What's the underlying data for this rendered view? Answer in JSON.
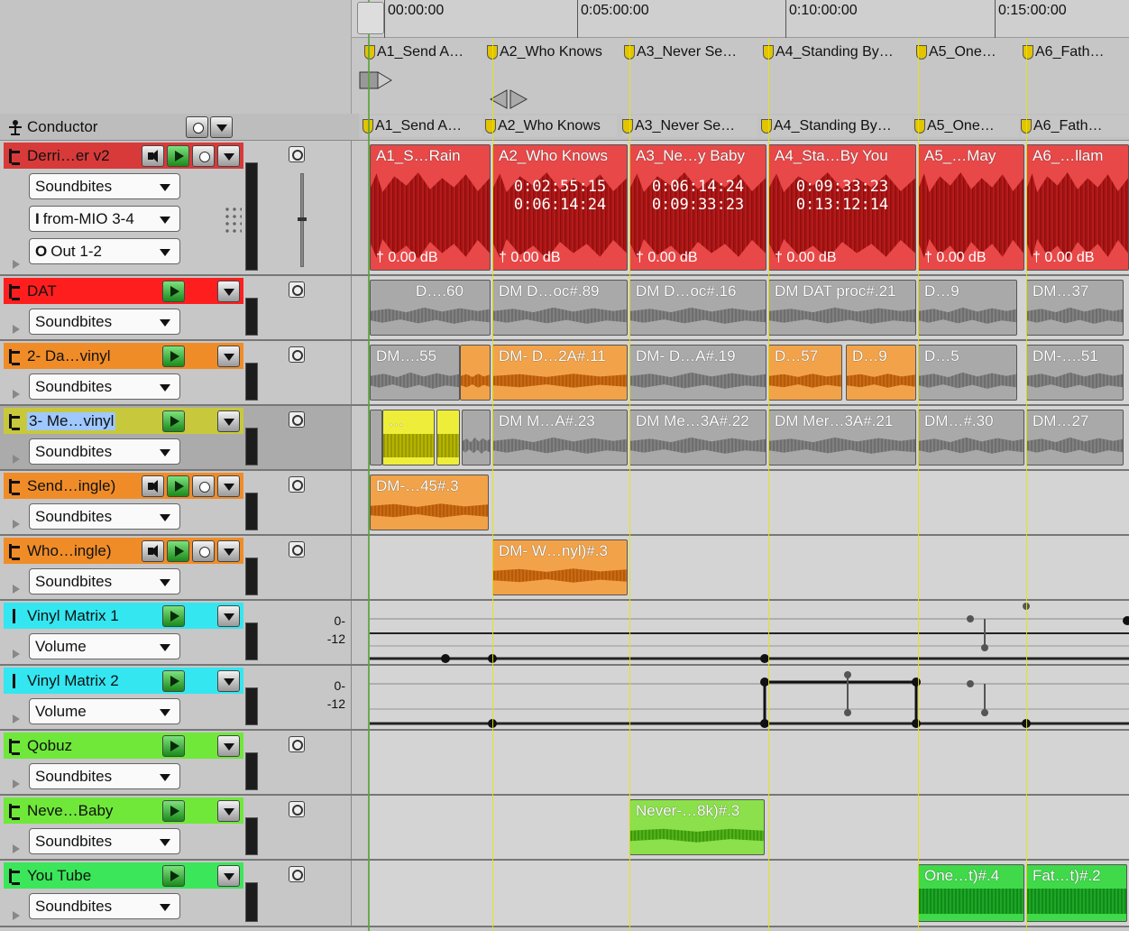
{
  "ruler": {
    "ticks": [
      "00:00:00",
      "0:05:00:00",
      "0:10:00:00",
      "0:15:00:00"
    ]
  },
  "markers": [
    {
      "label": "A1_Send A…"
    },
    {
      "label": "A2_Who Knows"
    },
    {
      "label": "A3_Never Se…"
    },
    {
      "label": "A4_Standing By…"
    },
    {
      "label": "A5_One…"
    },
    {
      "label": "A6_Fath…"
    }
  ],
  "conductor": {
    "label": "Conductor",
    "markers": [
      {
        "label": "A1_Send A…"
      },
      {
        "label": "A2_Who Knows"
      },
      {
        "label": "A3_Never Se…"
      },
      {
        "label": "A4_Standing By…"
      },
      {
        "label": "A5_One…"
      },
      {
        "label": "A6_Fath…"
      }
    ]
  },
  "tracks": [
    {
      "name": "Derri…er v2",
      "color": "#d83a3a",
      "dropdowns": [
        "Soundbites",
        "from-MIO 3-4",
        "Out 1-2"
      ],
      "clips": [
        {
          "title": "A1_S…Rain",
          "time_start": "",
          "time_end": "",
          "gain": "0.00 dB"
        },
        {
          "title": "A2_Who Knows",
          "time_start": "0:02:55:15",
          "time_end": "0:06:14:24",
          "gain": "0.00 dB"
        },
        {
          "title": "A3_Ne…y Baby",
          "time_start": "0:06:14:24",
          "time_end": "0:09:33:23",
          "gain": "0.00 dB"
        },
        {
          "title": "A4_Sta…By You",
          "time_start": "0:09:33:23",
          "time_end": "0:13:12:14",
          "gain": "0.00 dB"
        },
        {
          "title": "A5_…May",
          "time_start": "",
          "time_end": "",
          "gain": "0.00 dB"
        },
        {
          "title": "A6_…llam",
          "time_start": "",
          "time_end": "",
          "gain": "0.00 dB"
        }
      ]
    },
    {
      "name": "DAT",
      "color": "#ff1e1e",
      "dropdowns": [
        "Soundbites"
      ],
      "clips": [
        {
          "title": "D….60"
        },
        {
          "title": "DM D…oc#.89"
        },
        {
          "title": "DM D…oc#.16"
        },
        {
          "title": "DM DAT proc#.21"
        },
        {
          "title": "D…9"
        },
        {
          "title": "DM…37"
        }
      ]
    },
    {
      "name": "2- Da…vinyl",
      "color": "#f08c28",
      "dropdowns": [
        "Soundbites"
      ],
      "clips": [
        {
          "title": "DM….55"
        },
        {
          "title": "DM- D…2A#.11"
        },
        {
          "title": "DM- D…A#.19"
        },
        {
          "title": "D…57"
        },
        {
          "title": "D…9"
        },
        {
          "title": "D…5"
        },
        {
          "title": "DM-….51"
        }
      ]
    },
    {
      "name": "3- Me…vinyl",
      "color": "#c8c83c",
      "dropdowns": [
        "Soundbites"
      ],
      "clips": [
        {
          "title": "…"
        },
        {
          "title": "DM M…A#.23"
        },
        {
          "title": "DM Me…3A#.22"
        },
        {
          "title": "DM Mer…3A#.21"
        },
        {
          "title": "DM…#.30"
        },
        {
          "title": "DM…27"
        }
      ]
    },
    {
      "name": "Send…ingle)",
      "color": "#f08c28",
      "dropdowns": [
        "Soundbites"
      ],
      "clips": [
        {
          "title": "DM-…45#.3"
        }
      ]
    },
    {
      "name": "Who…ingle)",
      "color": "#f08c28",
      "dropdowns": [
        "Soundbites"
      ],
      "clips": [
        {
          "title": "DM- W…nyl)#.3"
        }
      ]
    },
    {
      "name": "Vinyl Matrix 1",
      "color": "#34e6f0",
      "dropdowns": [
        "Volume"
      ],
      "scale": [
        "0-",
        "-12"
      ]
    },
    {
      "name": "Vinyl Matrix 2",
      "color": "#34e6f0",
      "dropdowns": [
        "Volume"
      ],
      "scale": [
        "0-",
        "-12"
      ]
    },
    {
      "name": "Qobuz",
      "color": "#6fe83a",
      "dropdowns": [
        "Soundbites"
      ],
      "clips": []
    },
    {
      "name": "Neve…Baby",
      "color": "#6fe83a",
      "dropdowns": [
        "Soundbites"
      ],
      "clips": [
        {
          "title": "Never-…8k)#.3"
        }
      ]
    },
    {
      "name": "You Tube",
      "color": "#3ce65a",
      "dropdowns": [
        "Soundbites"
      ],
      "clips": [
        {
          "title": "One…t)#.4"
        },
        {
          "title": "Fat…t)#.2"
        }
      ]
    }
  ]
}
